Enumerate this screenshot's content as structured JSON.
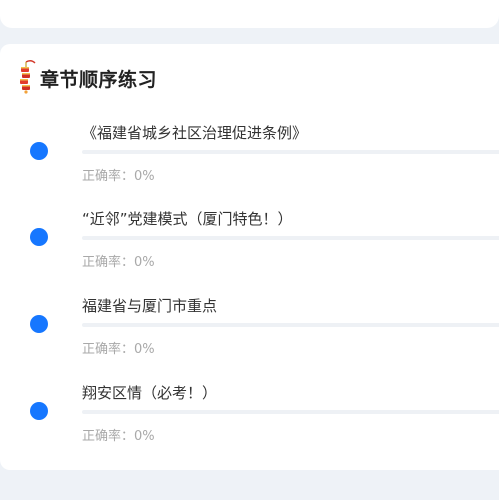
{
  "header": {
    "title": "章节顺序练习",
    "icon": "firecracker-icon"
  },
  "colors": {
    "accent": "#1677ff",
    "title_text": "#222222",
    "rate_text": "#a9a9a9",
    "background": "#eef2f7",
    "card": "#ffffff"
  },
  "chapters": [
    {
      "title": "《福建省城乡社区治理促进条例》",
      "rate_label": "正确率：0%",
      "progress": 0
    },
    {
      "title": "“近邻”党建模式（厦门特色！）",
      "rate_label": "正确率：0%",
      "progress": 0
    },
    {
      "title": "福建省与厦门市重点",
      "rate_label": "正确率：0%",
      "progress": 0
    },
    {
      "title": "翔安区情（必考！）",
      "rate_label": "正确率：0%",
      "progress": 0
    }
  ]
}
